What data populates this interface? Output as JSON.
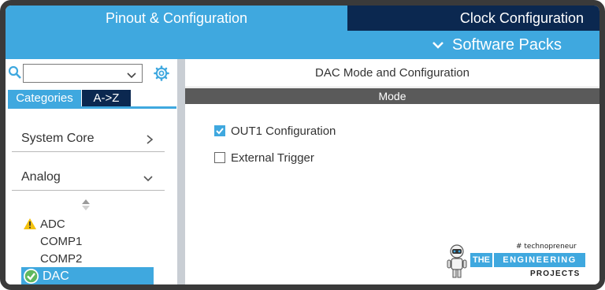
{
  "tabs": {
    "pinout": "Pinout & Configuration",
    "clock": "Clock Configuration"
  },
  "subbar": {
    "software_packs": "Software Packs"
  },
  "sidebar": {
    "search_value": "",
    "tab_categories": "Categories",
    "tab_az": "A->Z",
    "categories": [
      {
        "label": "System Core",
        "state": "collapsed"
      },
      {
        "label": "Analog",
        "state": "expanded"
      }
    ],
    "analog_items": [
      {
        "label": "ADC",
        "status": "warning"
      },
      {
        "label": "COMP1",
        "status": "none"
      },
      {
        "label": "COMP2",
        "status": "none"
      },
      {
        "label": "DAC",
        "status": "ok",
        "selected": true
      }
    ]
  },
  "panel": {
    "title": "DAC Mode and Configuration",
    "mode_header": "Mode",
    "options": [
      {
        "label": "OUT1 Configuration",
        "checked": true
      },
      {
        "label": "External Trigger",
        "checked": false
      }
    ]
  },
  "watermark": {
    "hashtag": "# technopreneur",
    "the": "THE",
    "name": "ENGINEERING",
    "sub": "PROJECTS"
  },
  "colors": {
    "accent": "#3fa8df",
    "dark_tab": "#0b2850",
    "mode_bar": "#5a5a5a",
    "warning": "#f4c20d",
    "ok": "#3fa8df"
  },
  "icons": [
    "search-icon",
    "chevron-down-icon",
    "gear-icon",
    "chevron-right-icon",
    "sort-icon",
    "warning-icon",
    "check-circle-icon",
    "checkmark-icon"
  ]
}
